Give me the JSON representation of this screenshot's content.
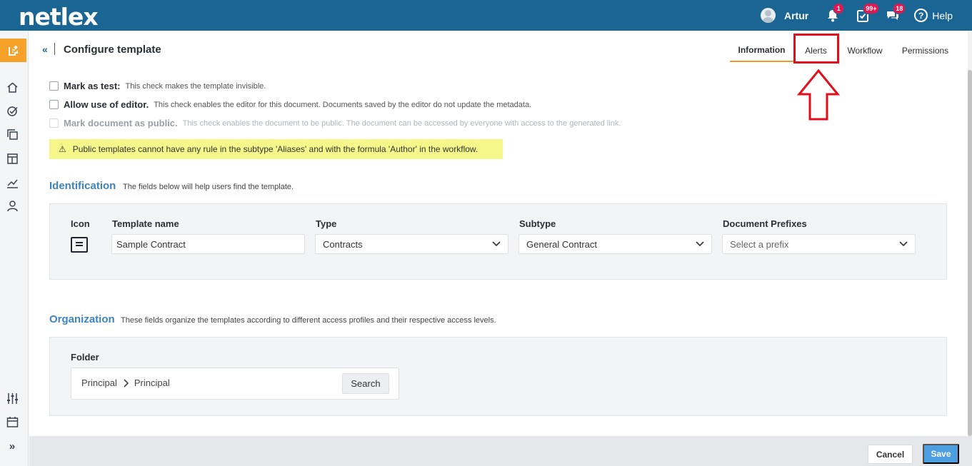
{
  "app": {
    "logo": "netlex"
  },
  "topbar": {
    "user_name": "Artur",
    "notifications_badge": "1",
    "tasks_badge": "99+",
    "messages_badge": "18",
    "help_label": "Help"
  },
  "header": {
    "back_icon": "«",
    "title": "Configure template"
  },
  "tabs": [
    {
      "label": "Information",
      "active": true
    },
    {
      "label": "Alerts",
      "active": false
    },
    {
      "label": "Workflow",
      "active": false
    },
    {
      "label": "Permissions",
      "active": false
    }
  ],
  "options": [
    {
      "label": "Mark as test:",
      "description": "This check makes the template invisible.",
      "checked": false,
      "disabled": false
    },
    {
      "label": "Allow use of editor.",
      "description": "This check enables the editor for this document. Documents saved by the editor do not update the metadata.",
      "checked": false,
      "disabled": false
    },
    {
      "label": "Mark document as public.",
      "description": "This check enables the document to be public. The document can be accessed by everyone with access to the generated link.",
      "checked": false,
      "disabled": true
    }
  ],
  "warning": {
    "icon": "⚠",
    "text": "Public templates cannot have any rule in the subtype 'Aliases' and with the formula 'Author' in the workflow."
  },
  "identification": {
    "title": "Identification",
    "description": "The fields below will help users find the template.",
    "icon_label": "Icon",
    "template_name_label": "Template name",
    "template_name_value": "Sample Contract",
    "type_label": "Type",
    "type_value": "Contracts",
    "subtype_label": "Subtype",
    "subtype_value": "General Contract",
    "prefixes_label": "Document Prefixes",
    "prefixes_placeholder": "Select a prefix"
  },
  "organization": {
    "title": "Organization",
    "description": "These fields organize the templates according to different access profiles and their respective access levels.",
    "folder_label": "Folder",
    "folder_path": [
      "Principal",
      "Principal"
    ],
    "search_label": "Search"
  },
  "footer": {
    "cancel_label": "Cancel",
    "save_label": "Save"
  },
  "colors": {
    "topbar": "#1b6594",
    "accent_orange": "#f29a28",
    "section_title": "#3e84bd",
    "save_button": "#4c9ee0",
    "annotation_red": "#e10e1c",
    "warning_bg": "#f5f78a"
  }
}
